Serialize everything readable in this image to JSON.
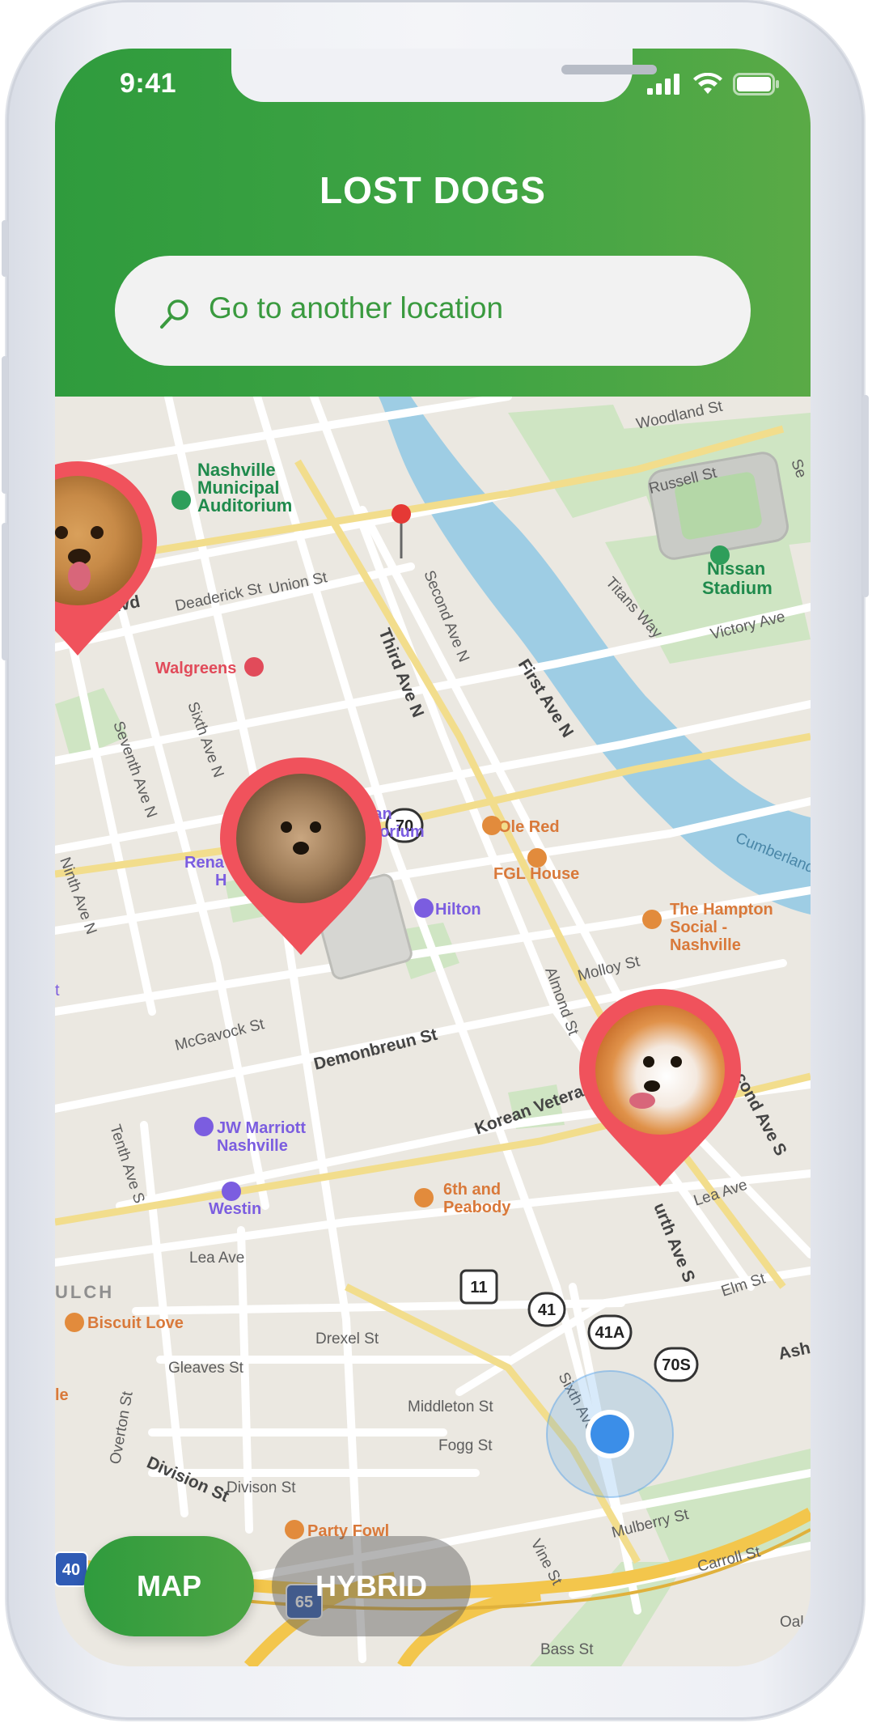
{
  "status_bar": {
    "time": "9:41"
  },
  "header": {
    "title": "LOST DOGS"
  },
  "search": {
    "placeholder": "Go to another location"
  },
  "map": {
    "labels": {
      "auditorium": [
        "Nashville",
        "Municipal",
        "Auditorium"
      ],
      "stadium": [
        "Nissan",
        "Stadium"
      ],
      "hampton": [
        "The Hampton",
        "Social -",
        "Nashville"
      ],
      "ryman": [
        "Ryman",
        "Auditorium"
      ],
      "jw_marriott": [
        "JW Marriott",
        "Nashville"
      ],
      "sixth_peabody": [
        "6th and",
        "Peabody"
      ],
      "walgreens": "Walgreens",
      "ole_red": "Ole Red",
      "fgl_house": "FGL House",
      "hilton": "Hilton",
      "westin": "Westin",
      "biscuit_love": "Biscuit Love",
      "party_fowl": "Party Fowl",
      "renaissance": "Rena",
      "renaissance2": "H",
      "gulch": "ULCH",
      "woodland": "Woodland St",
      "russell": "Russell St",
      "titans_way": "Titans Way",
      "victory_ave": "Victory Ave",
      "mlk": "ing Jr Blvd",
      "deaderick": "Deaderick St",
      "union": "Union St",
      "second_ave": "Second Ave N",
      "third_ave": "Third Ave N",
      "first_ave": "First Ave N",
      "sixth_ave_n": "Sixth Ave N",
      "seventh_ave": "Seventh Ave N",
      "ninth_ave": "Ninth Ave N",
      "cumberland": "Cumberland",
      "mcgavock": "McGavock St",
      "demonbreun": "Demonbreun St",
      "molloy": "Molloy St",
      "almond": "Almond St",
      "korean_veterans": "Korean Vetera",
      "second_ave_s": "cond Ave S",
      "fourth_ave_s": "urth Ave S",
      "tenth_ave": "Tenth Ave S",
      "lea_ave": "Lea Ave",
      "lea_ave2": "Lea Ave",
      "elm": "Elm St",
      "drexel": "Drexel St",
      "gleaves": "Gleaves St",
      "middleton": "Middleton St",
      "overton": "Overton St",
      "fogg": "Fogg St",
      "division": "Division St",
      "divison": "Divison St",
      "sixth_ave_s": "Sixth Ave S",
      "vine": "Vine St",
      "mulberry": "Mulberry St",
      "carroll": "Carroll St",
      "oak": "Oak",
      "bass": "Bass St",
      "ash": "Ash",
      "se": "Se",
      "t_edge": "t",
      "le_edge": "le"
    },
    "route_shields": {
      "r70": "70",
      "r11": "11",
      "r41": "41",
      "r41a": "41A",
      "r70s": "70S",
      "i40": "40",
      "i65": "65"
    }
  },
  "modes": {
    "map_label": "MAP",
    "hybrid_label": "HYBRID"
  },
  "colors": {
    "brand_green": "#3fa444",
    "pin_red": "#f0525c",
    "location_blue": "#3b8ee8"
  }
}
